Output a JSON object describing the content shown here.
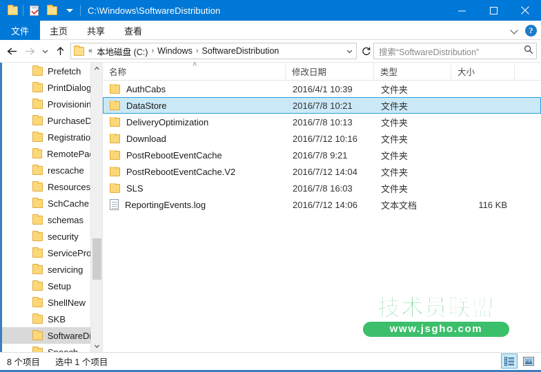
{
  "window": {
    "title_path": "C:\\Windows\\SoftwareDistribution",
    "quick_access": [
      {
        "name": "folder-icon",
        "label": "文件夹"
      },
      {
        "name": "properties-icon",
        "label": "属性"
      },
      {
        "name": "new-folder-icon",
        "label": "新建文件夹"
      },
      {
        "name": "customize-caret",
        "label": "自定义"
      }
    ],
    "controls": {
      "minimize": "最小化",
      "maximize": "最大化",
      "close": "关闭"
    }
  },
  "ribbon": {
    "tabs": [
      {
        "label": "文件",
        "active": true
      },
      {
        "label": "主页",
        "active": false
      },
      {
        "label": "共享",
        "active": false
      },
      {
        "label": "查看",
        "active": false
      }
    ],
    "expand_label": "展开功能区",
    "help_label": "?"
  },
  "address": {
    "back": "后退",
    "forward": "前进",
    "recent": "最近位置",
    "up": "向上",
    "overflow": "«",
    "crumbs": [
      "本地磁盘 (C:)",
      "Windows",
      "SoftwareDistribution"
    ],
    "separator": "›",
    "refresh": "刷新"
  },
  "search": {
    "placeholder": "搜索“SoftwareDistribution”",
    "value": ""
  },
  "nav_tree": {
    "items": [
      {
        "label": "Prefetch",
        "selected": false
      },
      {
        "label": "PrintDialog",
        "selected": false
      },
      {
        "label": "Provisionin",
        "selected": false
      },
      {
        "label": "PurchaseD",
        "selected": false
      },
      {
        "label": "Registratio",
        "selected": false
      },
      {
        "label": "RemotePac",
        "selected": false
      },
      {
        "label": "rescache",
        "selected": false
      },
      {
        "label": "Resources",
        "selected": false
      },
      {
        "label": "SchCache",
        "selected": false
      },
      {
        "label": "schemas",
        "selected": false
      },
      {
        "label": "security",
        "selected": false
      },
      {
        "label": "ServicePro",
        "selected": false
      },
      {
        "label": "servicing",
        "selected": false
      },
      {
        "label": "Setup",
        "selected": false
      },
      {
        "label": "ShellNew",
        "selected": false
      },
      {
        "label": "SKB",
        "selected": false
      },
      {
        "label": "SoftwareDi",
        "selected": true
      },
      {
        "label": "Speech",
        "selected": false
      }
    ]
  },
  "file_list": {
    "columns": [
      {
        "key": "name",
        "label": "名称"
      },
      {
        "key": "date",
        "label": "修改日期"
      },
      {
        "key": "type",
        "label": "类型"
      },
      {
        "key": "size",
        "label": "大小"
      }
    ],
    "sort_indicator": "˄",
    "rows": [
      {
        "icon": "folder-icon",
        "name": "AuthCabs",
        "date": "2016/4/1 10:39",
        "type": "文件夹",
        "size": "",
        "selected": false
      },
      {
        "icon": "folder-icon",
        "name": "DataStore",
        "date": "2016/7/8 10:21",
        "type": "文件夹",
        "size": "",
        "selected": true
      },
      {
        "icon": "folder-icon",
        "name": "DeliveryOptimization",
        "date": "2016/7/8 10:13",
        "type": "文件夹",
        "size": "",
        "selected": false
      },
      {
        "icon": "folder-icon",
        "name": "Download",
        "date": "2016/7/12 10:16",
        "type": "文件夹",
        "size": "",
        "selected": false
      },
      {
        "icon": "folder-icon",
        "name": "PostRebootEventCache",
        "date": "2016/7/8 9:21",
        "type": "文件夹",
        "size": "",
        "selected": false
      },
      {
        "icon": "folder-icon",
        "name": "PostRebootEventCache.V2",
        "date": "2016/7/12 14:04",
        "type": "文件夹",
        "size": "",
        "selected": false
      },
      {
        "icon": "folder-icon",
        "name": "SLS",
        "date": "2016/7/8 16:03",
        "type": "文件夹",
        "size": "",
        "selected": false
      },
      {
        "icon": "document-icon",
        "name": "ReportingEvents.log",
        "date": "2016/7/12 14:06",
        "type": "文本文档",
        "size": "116 KB",
        "selected": false
      }
    ]
  },
  "status": {
    "item_count": "8 个项目",
    "selection": "选中 1 个项目",
    "view_details": "详细信息",
    "view_large_icons": "大图标"
  },
  "watermark": {
    "brand": "技术员联盟",
    "url": "www.jsgho.com"
  },
  "colors": {
    "accent": "#0078d7",
    "selection_fill": "#cbe8f6",
    "selection_border": "#26a0da",
    "tree_selected": "#d9d9d9",
    "watermark_green": "#3cbf6a",
    "folder_yellow": "#fbd877"
  }
}
